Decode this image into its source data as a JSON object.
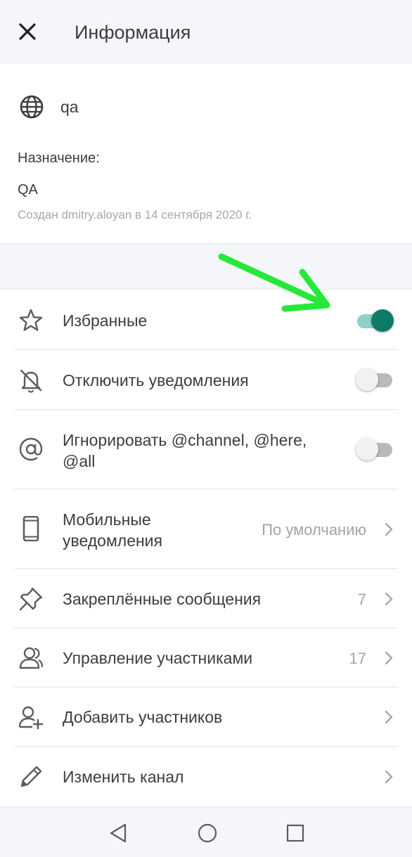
{
  "header": {
    "title": "Информация",
    "close_icon": "close-icon"
  },
  "info": {
    "channel_name": "qa",
    "purpose_label": "Назначение:",
    "purpose_value": "QA",
    "created_text": "Создан dmitry.aloyan в 14 сентября 2020 г."
  },
  "rows": {
    "favorites": {
      "label": "Избранные",
      "icon": "star-icon",
      "toggle_on": true
    },
    "mute": {
      "label": "Отключить уведомления",
      "icon": "bell-off-icon",
      "toggle_on": false
    },
    "ignore_mentions": {
      "label_line1": "Игнорировать @channel, @here,",
      "label_line2": "@all",
      "icon": "at-icon",
      "toggle_on": false
    },
    "mobile_notifications": {
      "label_line1": "Мобильные",
      "label_line2": "уведомления",
      "value": "По умолчанию",
      "icon": "phone-icon"
    },
    "pinned": {
      "label": "Закреплённые сообщения",
      "value": "7",
      "icon": "pin-icon"
    },
    "manage_members": {
      "label": "Управление участниками",
      "value": "17",
      "icon": "members-icon"
    },
    "add_members": {
      "label": "Добавить участников",
      "icon": "add-member-icon"
    },
    "edit_channel": {
      "label": "Изменить канал",
      "icon": "pencil-icon"
    }
  },
  "colors": {
    "accent": "#0e7b68",
    "toggle_track_on": "#8ecfc6",
    "annotation_arrow": "#27e83a",
    "header_bg": "#f4f6f9"
  },
  "navbar": {
    "icons": [
      "back-triangle-icon",
      "home-circle-icon",
      "recents-square-icon"
    ]
  }
}
